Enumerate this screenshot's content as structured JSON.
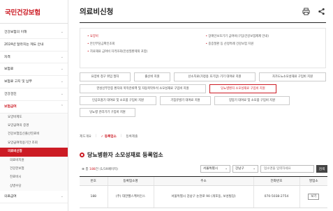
{
  "sidebar": {
    "logo": "국민건강보험",
    "menu": [
      {
        "label": "건강보험의 이해"
      },
      {
        "label": "2024년 달라지는 제도 안내"
      },
      {
        "label": "자격"
      },
      {
        "label": "보험료"
      },
      {
        "label": "보험료 고지 및 납부"
      },
      {
        "label": "건강검진"
      },
      {
        "label": "보험급여",
        "active": true
      }
    ],
    "sub_items": [
      {
        "label": "요양비제도"
      },
      {
        "label": "요양급여의 증명"
      },
      {
        "label": "건강보험임신출산진료비"
      },
      {
        "label": "요양급여적용기간 조회"
      },
      {
        "label": "의료비신청",
        "current": true
      },
      {
        "label": "의료비지원"
      },
      {
        "label": "건강한보험"
      },
      {
        "label": "진료비시"
      },
      {
        "label": "상병수당"
      }
    ],
    "bottom_item": "의료급여"
  },
  "header": {
    "title": "의료비신청",
    "print_icon": "print-icon",
    "share_icon": "share-icon"
  },
  "notice": {
    "items": [
      {
        "label": "요양비",
        "red": true
      },
      {
        "label": "장애인보조기기 급여비(구입/건강보험제제 안내)"
      },
      {
        "label": "본인부담금확인조회"
      },
      {
        "label": "중증질환 등 산정특례 건강보험 지원"
      },
      {
        "label": "치료재료 급여비 자격조회(만성질환제외 포함)"
      }
    ]
  },
  "buttons": {
    "row1": [
      "요양비 청구 위임 절차",
      "출산비 지원",
      "산소치료(가정용 호기장) 기기 대여료 지원",
      "자가도뇨소모성재료 구입비 지원"
    ],
    "row2": [
      "만성신부전증 환자의 복막관류액 및 자동복막투석 소모성재료 구입비 지원",
      "당뇨병환자 소모성재료 구입비 지원"
    ],
    "row3": [
      "인공호흡기 대여료 및 소모품 구입비 지원",
      "기침유발기 대여료 지원",
      "양압기 대여료 및 소모품 구입비 지원"
    ],
    "row4": [
      "당뇨병 관리기기 구입비 지원"
    ]
  },
  "tabs": [
    {
      "label": "제도개요",
      "on": false
    },
    {
      "label": "등록업소",
      "on": true
    },
    {
      "label": "등록제출",
      "on": false
    }
  ],
  "section": {
    "title": "당뇨병환자 소모성재료 등록업소"
  },
  "filter": {
    "count_prefix": "총",
    "count": "188",
    "count_suffix": "건 (1/19페이지)",
    "sido": "서울특별시",
    "sigungu": "강남구",
    "search_placeholder": "업소명을 입력하세요",
    "search_button": "검색"
  },
  "table": {
    "headers": [
      "번호",
      "등록업소명",
      "주소",
      "전화번호",
      "영업소"
    ],
    "rows": [
      {
        "no": "188",
        "name": "(주) 대한헬스케어인스",
        "address": "서울특별시 강남구 논현로 90 (개포동, 보성빌딩)",
        "phone": "070-5038-2754",
        "action": "보기"
      }
    ]
  }
}
